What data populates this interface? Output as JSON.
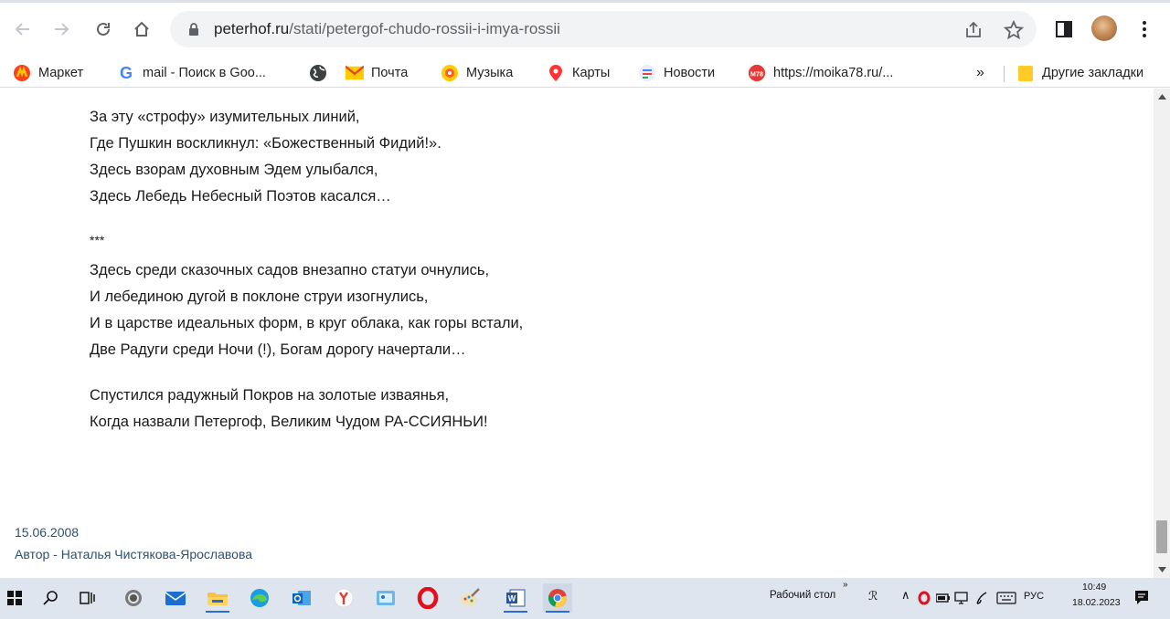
{
  "browser": {
    "url_domain": "peterhof.ru",
    "url_path": "/stati/petergof-chudo-rossii-i-imya-rossii"
  },
  "bookmarks": {
    "items": [
      {
        "label": "Маркет",
        "icon": "yandex-market-icon"
      },
      {
        "label": "mail - Поиск в Goo...",
        "icon": "google-icon"
      },
      {
        "label": "",
        "icon": "globe-icon"
      },
      {
        "label": "Почта",
        "icon": "mail-icon"
      },
      {
        "label": "Музыка",
        "icon": "music-icon"
      },
      {
        "label": "Карты",
        "icon": "maps-pin-icon"
      },
      {
        "label": "Новости",
        "icon": "news-icon"
      },
      {
        "label": "https://moika78.ru/...",
        "icon": "m78-icon"
      }
    ],
    "overflow": "»",
    "other_folder": "Другие закладки"
  },
  "article": {
    "stanza1": [
      "За эту «строфу» изумительных линий,",
      "Где Пушкин воскликнул: «Божественный Фидий!».",
      "Здесь взорам духовным Эдем улыбался,",
      "Здесь Лебедь Небесный Поэтов касался…"
    ],
    "separator": "***",
    "stanza2": [
      "Здесь среди сказочных садов внезапно статуи очнулись,",
      "И лебединою дугой в поклоне струи изогнулись,",
      "И в царстве идеальных форм, в круг облака, как горы встали,",
      "Две Радуги среди Ночи (!), Богам дорогу начертали…"
    ],
    "stanza3": [
      "Спустился радужный Покров на золотые изваянья,",
      "Когда назвали Петергоф, Великим Чудом РА-ССИЯНЬИ!"
    ],
    "date": "15.06.2008",
    "author": "Автор - Наталья Чистякова-Ярославова"
  },
  "taskbar": {
    "desktop_label": "Рабочий стол",
    "language": "РУС",
    "time": "10:49",
    "date": "18.02.2023"
  },
  "colors": {
    "accent": "#1a73e8",
    "taskbar_bg": "#dfe5ee",
    "meta_text": "#2f4f6f"
  }
}
